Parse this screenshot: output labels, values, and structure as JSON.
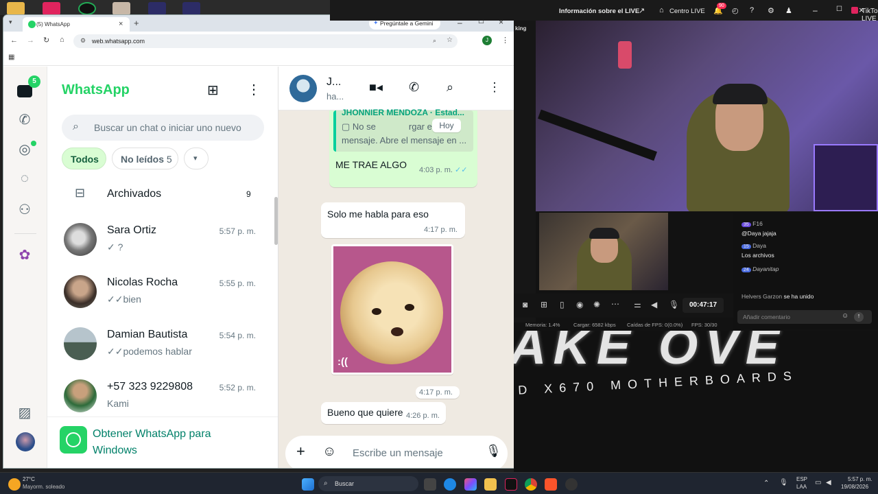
{
  "desktop": {
    "top_icons": [
      "folder-icon",
      "tiktok-icon",
      "obs-icon",
      "photo-icon",
      "app-icon",
      "app-icon"
    ]
  },
  "browser": {
    "tab_title": "(5) WhatsApp",
    "url": "web.whatsapp.com",
    "gemini_label": "Pregúntale a Gemini",
    "profile_initial": "J"
  },
  "whatsapp": {
    "title": "WhatsApp",
    "chats_badge": "5",
    "search_placeholder": "Buscar un chat o iniciar uno nuevo",
    "filters": {
      "all": "Todos",
      "unread": "No leídos",
      "unread_count": "5"
    },
    "archived": {
      "label": "Archivados",
      "count": "9"
    },
    "chats": [
      {
        "name": "Sara Ortiz",
        "time": "5:57 p. m.",
        "preview": "?",
        "tick": "✓"
      },
      {
        "name": "Nicolas Rocha",
        "time": "5:55 p. m.",
        "preview": "bien",
        "tick": "✓✓"
      },
      {
        "name": "Damian Bautista",
        "time": "5:54 p. m.",
        "preview": "podemos hablar",
        "tick": "✓✓"
      },
      {
        "name": "+57 323 9229808",
        "time": "5:52 p. m.",
        "preview": "Kami",
        "tick": ""
      }
    ],
    "get_app": "Obtener WhatsApp para Windows",
    "conversation": {
      "name": "J...",
      "status": "ha...",
      "quoted_author": "JHONNIER MENDOZA · Estad...",
      "quoted_text_1": "No se",
      "quoted_text_1b": "rgar este",
      "quoted_text_2": "mensaje. Abre el mensaje en ...",
      "date_chip": "Hoy",
      "messages": [
        {
          "text": "ME TRAE ALGO",
          "time": "4:03 p. m."
        },
        {
          "text": "Solo me habla para eso",
          "time": "4:17 p. m."
        },
        {
          "caption": ":((",
          "time": "4:17 p. m."
        },
        {
          "text": "Bueno que quiere",
          "time": "4:26 p. m."
        }
      ],
      "compose_placeholder": "Escribe un mensaje"
    }
  },
  "tiktok": {
    "app_title": "TikTok LIVE Studio",
    "info_label": "Información sobre el LIVE",
    "center_label": "Centro LIVE",
    "notif_count": "90",
    "side_label": "king",
    "timer": "00:47:17",
    "stats": {
      "memory": "Memoria: 1.4%",
      "load": "Cargar: 6582 kbps",
      "fps_drops": "Caídas de FPS: 0(0.0%)",
      "fps": "FPS: 30/30"
    },
    "chat": [
      {
        "badge": "35",
        "user": "F16",
        "line2": "@Daya jajaja"
      },
      {
        "badge": "15",
        "user": "Daya",
        "line2": "Los archivos"
      },
      {
        "badge": "24",
        "user": "Dayanitap",
        "line2": ""
      }
    ],
    "join_user": "Helvers Garzon",
    "join_text": "se ha unido",
    "comment_placeholder": "Añadir comentario",
    "banner_big": "AKE OVE",
    "banner_small": "D X670 MOTHERBOARDS"
  },
  "taskbar": {
    "weather_temp": "27°C",
    "weather_desc": "Mayorm. soleado",
    "search_label": "Buscar",
    "lang": "ESP",
    "lang_sub": "LAA",
    "time": "5:57 p. m.",
    "date": "19/08/2026"
  }
}
